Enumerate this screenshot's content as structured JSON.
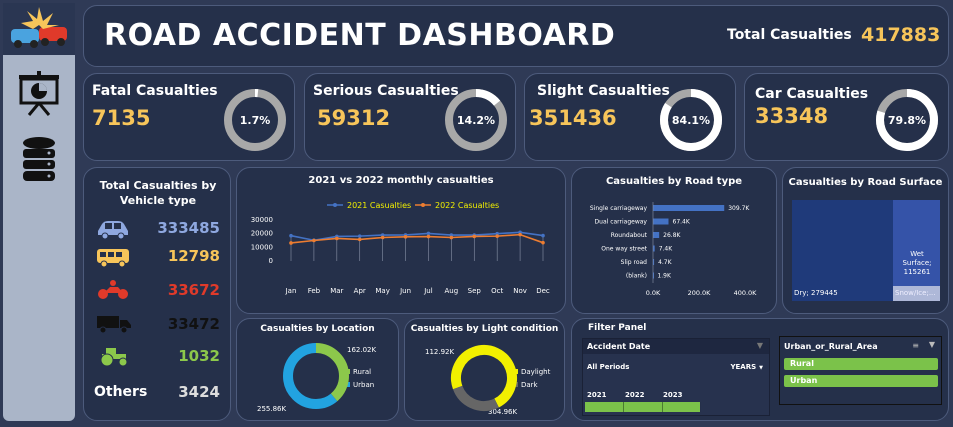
{
  "header": {
    "title": "ROAD ACCIDENT DASHBOARD",
    "total_label": "Total Casualties",
    "total_value": "417883"
  },
  "sidebar": {
    "icons": [
      "crash-logo-icon",
      "presentation-chart-icon",
      "database-icon"
    ]
  },
  "kpis": [
    {
      "label": "Fatal Casualties",
      "value": "7135",
      "pct_label": "1.7%",
      "pct": 0.017
    },
    {
      "label": "Serious Casualties",
      "value": "59312",
      "pct_label": "14.2%",
      "pct": 0.142
    },
    {
      "label": "Slight Casualties",
      "value": "351436",
      "pct_label": "84.1%",
      "pct": 0.841
    },
    {
      "label": "Car Casualties",
      "value": "33348",
      "pct_label": "79.8%",
      "pct": 0.798
    }
  ],
  "vehicle_panel": {
    "title": "Total Casualties by Vehicle type",
    "rows": [
      {
        "icon": "car-icon",
        "value": "333485",
        "color": "#8fa8e0"
      },
      {
        "icon": "bus-icon",
        "value": "12798",
        "color": "#f7c55a"
      },
      {
        "icon": "motorcycle-icon",
        "value": "33672",
        "color": "#e03a2a"
      },
      {
        "icon": "truck-icon",
        "value": "33472",
        "color": "#111111"
      },
      {
        "icon": "tractor-icon",
        "value": "1032",
        "color": "#8cc84b"
      },
      {
        "label": "Others",
        "value": "3424",
        "color": "#dddddd"
      }
    ]
  },
  "chart_data": [
    {
      "type": "line",
      "title": "2021 vs 2022 monthly casualties",
      "categories": [
        "Jan",
        "Feb",
        "Mar",
        "Apr",
        "May",
        "Jun",
        "Jul",
        "Aug",
        "Sep",
        "Oct",
        "Nov",
        "Dec"
      ],
      "series": [
        {
          "name": "2021 Casualties",
          "color": "#4472c4",
          "values": [
            18500,
            15200,
            18000,
            18200,
            19000,
            19100,
            20200,
            19000,
            19000,
            20000,
            21000,
            18600
          ]
        },
        {
          "name": "2022 Casualties",
          "color": "#ed7d31",
          "values": [
            13200,
            15000,
            16500,
            15800,
            17200,
            17700,
            17900,
            17200,
            18000,
            18200,
            19300,
            13400
          ]
        }
      ],
      "ylim": [
        0,
        30000
      ],
      "yticks": [
        "30000",
        "20000",
        "10000",
        "0"
      ],
      "grid": false,
      "legend": "top"
    },
    {
      "type": "bar",
      "title": "Casualties by Road type",
      "categories": [
        "Single carriageway",
        "Dual carriageway",
        "Roundabout",
        "One way street",
        "Slip road",
        "(blank)"
      ],
      "values": [
        309.7,
        67.4,
        26.8,
        7.4,
        4.7,
        1.9
      ],
      "data_labels": [
        "309.7K",
        "67.4K",
        "26.8K",
        "7.4K",
        "4.7K",
        "1.9K"
      ],
      "xticks": [
        "0.0K",
        "200.0K",
        "400.0K"
      ],
      "xlim": [
        0,
        400
      ]
    },
    {
      "type": "heatmap",
      "title": "Casualties by Road Surface",
      "cells": [
        {
          "label": "Dry; 279445",
          "value": 279445,
          "color": "#1f3a7a"
        },
        {
          "label": "Wet Surface; 115261",
          "value": 115261,
          "color": "#3553a8"
        },
        {
          "label": "Snow/Ice;...",
          "value": 23177,
          "color": "#aeb8d8"
        }
      ]
    },
    {
      "type": "pie",
      "title": "Casualties by Location",
      "series": [
        {
          "name": "Rural",
          "value": 162.02,
          "label": "162.02K",
          "color": "#8cc84b"
        },
        {
          "name": "Urban",
          "value": 255.86,
          "label": "255.86K",
          "color": "#22a3e0"
        }
      ]
    },
    {
      "type": "pie",
      "title": "Casualties by Light condition",
      "series": [
        {
          "name": "Daylight",
          "value": 304.96,
          "label": "304.96K",
          "color": "#f2f000"
        },
        {
          "name": "Dark",
          "value": 112.92,
          "label": "112.92K",
          "color": "#666666"
        }
      ]
    }
  ],
  "filter_panel": {
    "title": "Filter Panel",
    "date_header": "Accident Date",
    "period_label": "All Periods",
    "granularity": "YEARS",
    "years": [
      "2021",
      "2022",
      "2023"
    ],
    "area_header": "Urban_or_Rural_Area",
    "area_options": [
      "Rural",
      "Urban"
    ]
  }
}
